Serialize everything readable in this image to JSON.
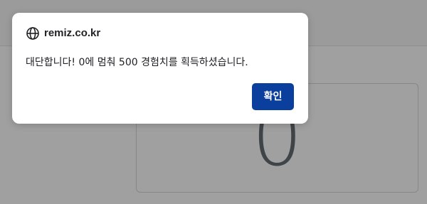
{
  "background": {
    "counter_value": "0"
  },
  "dialog": {
    "origin": "remiz.co.kr",
    "message": "대단합니다! 0에 멈춰 500 경험치를 획득하셨습니다.",
    "confirm_label": "확인",
    "icons": {
      "origin_icon": "globe-icon"
    },
    "colors": {
      "confirm_button": "#0b3f9e"
    }
  }
}
